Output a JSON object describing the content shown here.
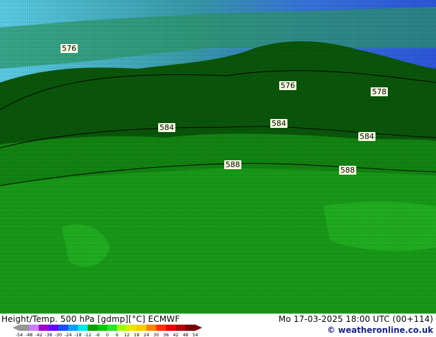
{
  "map": {
    "contour_labels": [
      "576",
      "576",
      "578",
      "584",
      "584",
      "584",
      "588",
      "588"
    ]
  },
  "footer": {
    "title": "Height/Temp. 500 hPa [gdmp][°C] ECMWF",
    "date": "Mo 17-03-2025 18:00 UTC (00+114)",
    "credit": "© weatheronline.co.uk"
  },
  "scale": {
    "ticks": [
      "-54",
      "-48",
      "-42",
      "-38",
      "-30",
      "-24",
      "-18",
      "-12",
      "-6",
      "0",
      "6",
      "12",
      "18",
      "24",
      "30",
      "36",
      "42",
      "48",
      "54"
    ],
    "colors": [
      "#969696",
      "#c87dff",
      "#a000c8",
      "#6400ff",
      "#1450ff",
      "#00a0ff",
      "#00e6e6",
      "#00a000",
      "#00c800",
      "#28e628",
      "#a0ff00",
      "#e6e600",
      "#ffc800",
      "#ff8200",
      "#ff3200",
      "#e60000",
      "#b40000",
      "#780000"
    ]
  }
}
